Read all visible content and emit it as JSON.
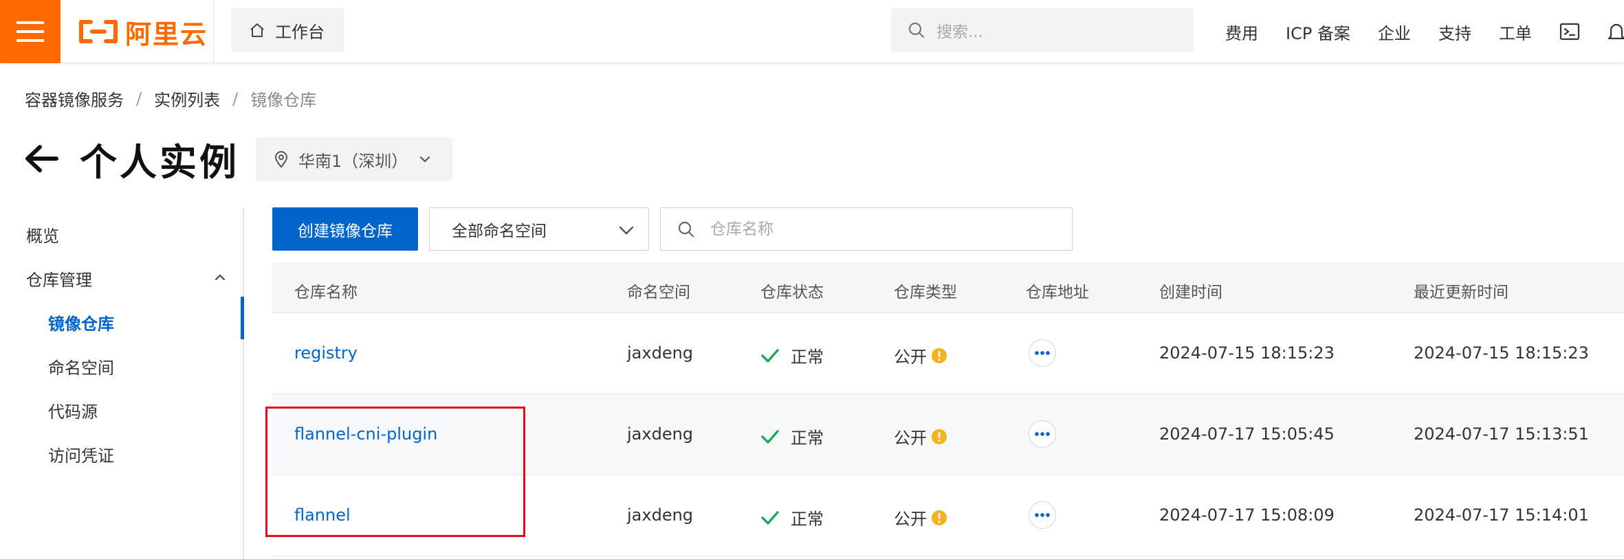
{
  "header": {
    "logo_text": "阿里云",
    "workbench_label": "工作台",
    "search_placeholder": "搜索...",
    "nav": [
      "费用",
      "ICP 备案",
      "企业",
      "支持",
      "工单"
    ],
    "brand_color": "#ff6a00"
  },
  "breadcrumb": [
    "容器镜像服务",
    "实例列表",
    "镜像仓库"
  ],
  "page": {
    "title": "个人实例",
    "region": "华南1（深圳）"
  },
  "sidebar": {
    "overview": "概览",
    "repo_management": "仓库管理",
    "items": [
      "镜像仓库",
      "命名空间",
      "代码源",
      "访问凭证"
    ],
    "active_item": "镜像仓库",
    "accent_color": "#0064c8"
  },
  "toolbar": {
    "create_label": "创建镜像仓库",
    "namespace_select": "全部命名空间",
    "repo_search_placeholder": "仓库名称"
  },
  "table": {
    "columns": [
      "仓库名称",
      "命名空间",
      "仓库状态",
      "仓库类型",
      "仓库地址",
      "创建时间",
      "最近更新时间"
    ],
    "rows": [
      {
        "name": "registry",
        "namespace": "jaxdeng",
        "status": "正常",
        "type": "公开",
        "created": "2024-07-15 18:15:23",
        "updated": "2024-07-15 18:15:23"
      },
      {
        "name": "flannel-cni-plugin",
        "namespace": "jaxdeng",
        "status": "正常",
        "type": "公开",
        "created": "2024-07-17 15:05:45",
        "updated": "2024-07-17 15:13:51"
      },
      {
        "name": "flannel",
        "namespace": "jaxdeng",
        "status": "正常",
        "type": "公开",
        "created": "2024-07-17 15:08:09",
        "updated": "2024-07-17 15:14:01"
      }
    ]
  }
}
